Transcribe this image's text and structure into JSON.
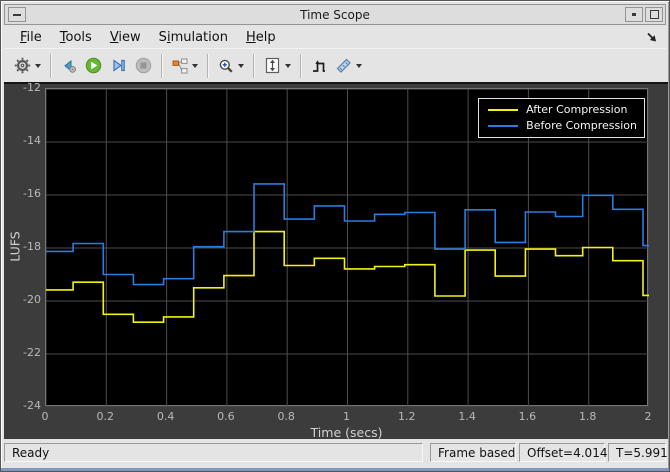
{
  "window": {
    "title": "Time Scope"
  },
  "menu": {
    "items": [
      {
        "label": "File",
        "underline": 0
      },
      {
        "label": "Tools",
        "underline": 0
      },
      {
        "label": "View",
        "underline": 0
      },
      {
        "label": "Simulation",
        "underline": 1
      },
      {
        "label": "Help",
        "underline": 0
      }
    ]
  },
  "toolbar": {
    "buttons": [
      "settings",
      "step-back",
      "run",
      "step-forward",
      "stop",
      "signal-selector",
      "zoom-in",
      "scale-axes",
      "trigger",
      "measurements"
    ]
  },
  "colors": {
    "canvas_bg": "#3c3c3c",
    "axes_bg": "#000000",
    "grid": "#4d4d4d",
    "tick_text": "#b9b9b9",
    "label_text": "#d2d2d2",
    "after_compression": "#f3f311",
    "before_compression": "#2a7cdf"
  },
  "chart_data": {
    "type": "line",
    "subtype": "stairstep",
    "title": "",
    "xlabel": "Time (secs)",
    "ylabel": "LUFS",
    "xlim": [
      0,
      2
    ],
    "ylim": [
      -24,
      -12
    ],
    "grid": true,
    "legend_position": "top-right",
    "x_tick_values": [
      0,
      0.2,
      0.4,
      0.6,
      0.8,
      1,
      1.2,
      1.4,
      1.6,
      1.8,
      2
    ],
    "x_tick_labels": [
      "0",
      "0.2",
      "0.4",
      "0.6",
      "0.8",
      "1",
      "1.2",
      "1.4",
      "1.6",
      "1.8",
      "2"
    ],
    "y_tick_values": [
      -12,
      -14,
      -16,
      -18,
      -20,
      -22,
      -24
    ],
    "y_tick_labels": [
      "-12",
      "-14",
      "-16",
      "-18",
      "-20",
      "-22",
      "-24"
    ],
    "series": [
      {
        "name": "After Compression",
        "color": "#f3f311",
        "steps": [
          [
            0,
            -19.58
          ],
          [
            0.09,
            -19.29
          ],
          [
            0.19,
            -20.5
          ],
          [
            0.29,
            -20.8
          ],
          [
            0.39,
            -20.6
          ],
          [
            0.49,
            -19.5
          ],
          [
            0.59,
            -19.04
          ],
          [
            0.69,
            -17.38
          ],
          [
            0.79,
            -18.66
          ],
          [
            0.89,
            -18.39
          ],
          [
            0.99,
            -18.79
          ],
          [
            1.09,
            -18.7
          ],
          [
            1.19,
            -18.63
          ],
          [
            1.29,
            -19.81
          ],
          [
            1.39,
            -18.08
          ],
          [
            1.49,
            -19.06
          ],
          [
            1.59,
            -18.04
          ],
          [
            1.69,
            -18.29
          ],
          [
            1.78,
            -17.98
          ],
          [
            1.88,
            -18.48
          ],
          [
            1.98,
            -19.79
          ]
        ]
      },
      {
        "name": "Before Compression",
        "color": "#2a7cdf",
        "steps": [
          [
            0,
            -18.13
          ],
          [
            0.09,
            -17.83
          ],
          [
            0.19,
            -19.0
          ],
          [
            0.29,
            -19.38
          ],
          [
            0.39,
            -19.16
          ],
          [
            0.49,
            -17.95
          ],
          [
            0.59,
            -17.38
          ],
          [
            0.69,
            -15.58
          ],
          [
            0.79,
            -16.91
          ],
          [
            0.89,
            -16.41
          ],
          [
            0.99,
            -16.98
          ],
          [
            1.09,
            -16.73
          ],
          [
            1.19,
            -16.66
          ],
          [
            1.29,
            -18.04
          ],
          [
            1.39,
            -16.56
          ],
          [
            1.49,
            -17.79
          ],
          [
            1.59,
            -16.64
          ],
          [
            1.69,
            -16.81
          ],
          [
            1.78,
            -16.01
          ],
          [
            1.88,
            -16.54
          ],
          [
            1.98,
            -17.91
          ]
        ]
      }
    ]
  },
  "statusbar": {
    "ready": "Ready",
    "panels": [
      "Frame based",
      "Offset=4.014",
      "T=5.991"
    ]
  }
}
